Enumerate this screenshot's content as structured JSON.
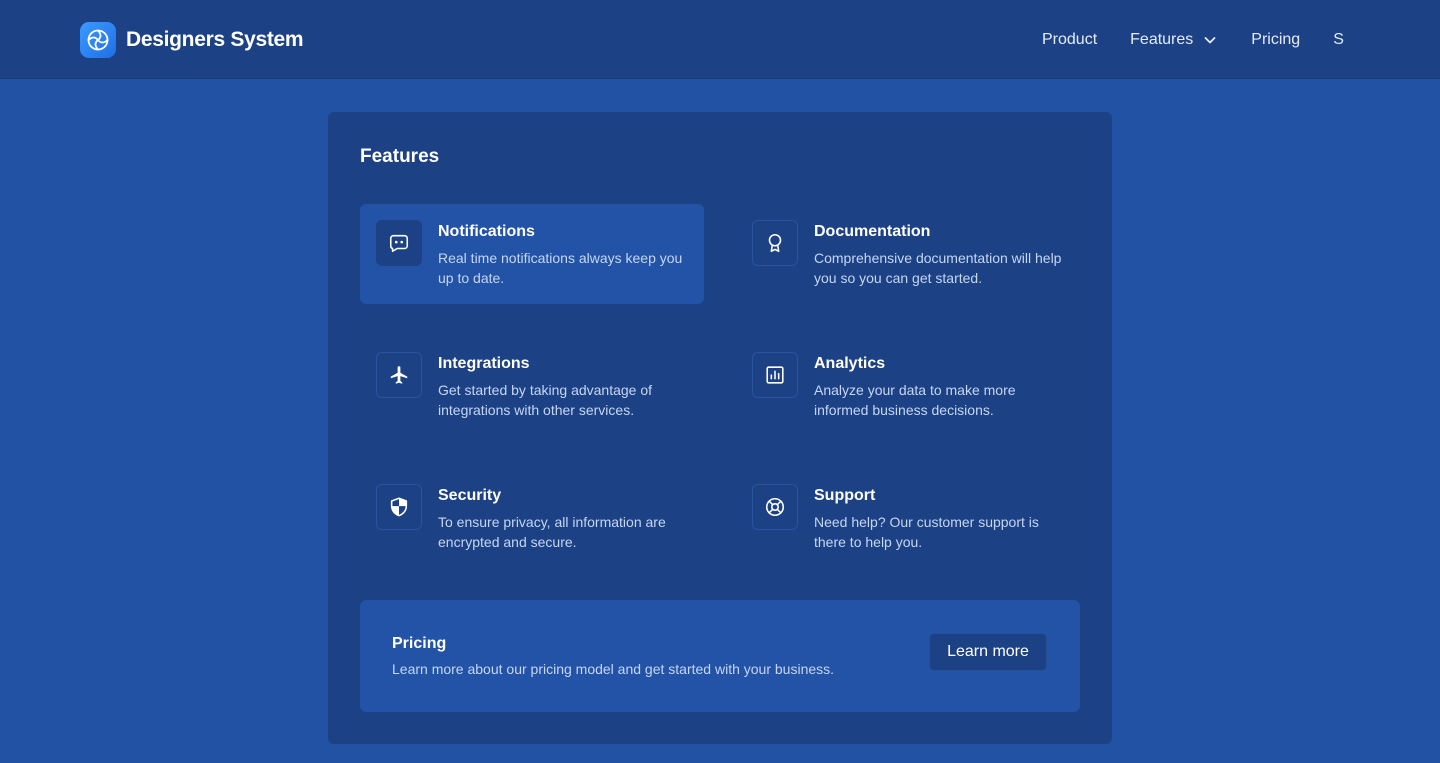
{
  "brand": {
    "name": "Designers System",
    "logo_icon": "aperture-icon"
  },
  "nav": {
    "product": "Product",
    "features": "Features",
    "pricing": "Pricing",
    "more": "S"
  },
  "dropdown": {
    "title": "Features",
    "items": [
      {
        "title": "Notifications",
        "description": "Real time notifications always keep you up to date.",
        "icon": "chat-bubble-icon",
        "active": true
      },
      {
        "title": "Documentation",
        "description": "Comprehensive documentation will help you so you can get started.",
        "icon": "award-icon"
      },
      {
        "title": "Integrations",
        "description": "Get started by taking advantage of integrations with other services.",
        "icon": "airplane-icon"
      },
      {
        "title": "Analytics",
        "description": "Analyze your data to make more informed business decisions.",
        "icon": "bar-chart-icon"
      },
      {
        "title": "Security",
        "description": "To ensure privacy, all information are encrypted and secure.",
        "icon": "shield-icon"
      },
      {
        "title": "Support",
        "description": "Need help? Our customer support is there to help you.",
        "icon": "lifebuoy-icon"
      }
    ],
    "pricing": {
      "title": "Pricing",
      "description": "Learn more about our pricing model and get started with your business.",
      "button": "Learn more"
    }
  },
  "colors": {
    "page_bg": "#2152a3",
    "navbar_bg": "#1c4185",
    "panel_bg": "#1c4185",
    "highlight_bg": "#2253a6",
    "accent": "#2f86f6"
  }
}
